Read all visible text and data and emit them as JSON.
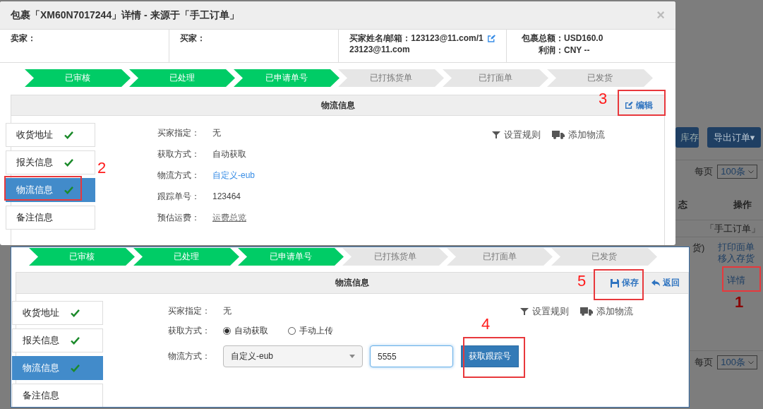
{
  "background_page": {
    "buttons": [
      {
        "label": "库存"
      },
      {
        "label": "导出订单",
        "caret": "▾"
      }
    ],
    "page_size_top": {
      "label": "每页",
      "value": "100条"
    },
    "columns": [
      "态",
      "操作"
    ],
    "source_tag": "「手工订单」",
    "row_status": "货)",
    "actions": [
      "打印面单",
      "移入存货",
      "详情"
    ],
    "page_size_bottom": {
      "label": "每页",
      "value": "100条"
    }
  },
  "detail_dialog": {
    "title": "包裹「XM60N7017244」详情 - 来源于「手工订单」",
    "close": "×",
    "seller": "卖家：",
    "buyer": "买家：",
    "buyer_email": "买家姓名/邮箱：123123@11.com/123123@11.com",
    "total": {
      "label": "包裹总额：",
      "value": "USD160.0"
    },
    "profit": {
      "label": "利润：",
      "value": "CNY --"
    },
    "steps": [
      {
        "label": "已审核",
        "done": true
      },
      {
        "label": "已处理",
        "done": true
      },
      {
        "label": "已申请单号",
        "done": true
      },
      {
        "label": "已打拣货单",
        "done": false
      },
      {
        "label": "已打面单",
        "done": false
      },
      {
        "label": "已发货",
        "done": false
      }
    ],
    "section_title": "物流信息",
    "edit_button": "编辑",
    "tabs": [
      {
        "label": "收货地址",
        "complete": true,
        "selected": false
      },
      {
        "label": "报关信息",
        "complete": true,
        "selected": false
      },
      {
        "label": "物流信息",
        "complete": true,
        "selected": true
      },
      {
        "label": "备注信息",
        "complete": false,
        "selected": false
      }
    ],
    "tools": [
      "设置规则",
      "添加物流"
    ],
    "fields": [
      {
        "kind": "text",
        "label": "买家指定：",
        "value": "无"
      },
      {
        "kind": "text",
        "label": "获取方式：",
        "value": "自动获取"
      },
      {
        "kind": "link",
        "label": "物流方式：",
        "value": "自定义-eub"
      },
      {
        "kind": "text",
        "label": "跟踪单号：",
        "value": "123464"
      },
      {
        "kind": "underline",
        "label": "预估运费：",
        "value": "运费总览"
      }
    ]
  },
  "edit_panel": {
    "steps": [
      {
        "label": "已审核",
        "done": true
      },
      {
        "label": "已处理",
        "done": true
      },
      {
        "label": "已申请单号",
        "done": true
      },
      {
        "label": "已打拣货单",
        "done": false
      },
      {
        "label": "已打面单",
        "done": false
      },
      {
        "label": "已发货",
        "done": false
      }
    ],
    "section_title": "物流信息",
    "save_button": "保存",
    "back_button": "返回",
    "tabs": [
      {
        "label": "收货地址",
        "complete": true,
        "selected": false
      },
      {
        "label": "报关信息",
        "complete": true,
        "selected": false
      },
      {
        "label": "物流信息",
        "complete": true,
        "selected": true
      },
      {
        "label": "备注信息",
        "complete": false,
        "selected": false
      }
    ],
    "tools": [
      "设置规则",
      "添加物流"
    ],
    "fields": [
      {
        "kind": "text",
        "label": "买家指定：",
        "value": "无"
      },
      {
        "kind": "radio",
        "label": "获取方式：",
        "options": [
          {
            "label": "自动获取",
            "selected": true
          },
          {
            "label": "手动上传",
            "selected": false
          }
        ]
      },
      {
        "kind": "select",
        "label": "物流方式：",
        "value": "自定义-eub",
        "tracking_value": "5555",
        "button": "获取跟踪号"
      }
    ]
  },
  "annotations": [
    {
      "label": "1"
    },
    {
      "label": "2"
    },
    {
      "label": "3"
    },
    {
      "label": "4"
    },
    {
      "label": "5"
    }
  ]
}
